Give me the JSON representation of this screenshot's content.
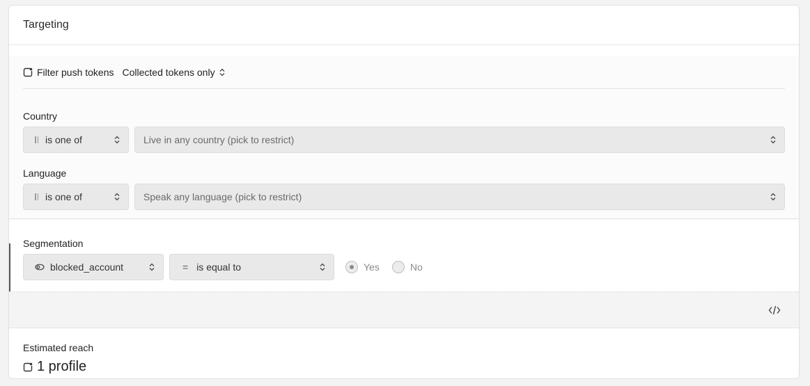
{
  "card": {
    "title": "Targeting"
  },
  "push": {
    "label": "Filter push tokens",
    "value": "Collected tokens only"
  },
  "country": {
    "label": "Country",
    "operator": "is one of",
    "placeholder": "Live in any country (pick to restrict)"
  },
  "language": {
    "label": "Language",
    "operator": "is one of",
    "placeholder": "Speak any language (pick to restrict)"
  },
  "segmentation": {
    "label": "Segmentation",
    "attribute": "blocked_account",
    "comparator_symbol": "=",
    "comparator": "is equal to",
    "options": [
      "Yes",
      "No"
    ],
    "selected": "Yes"
  },
  "reach": {
    "label": "Estimated reach",
    "value": "1 profile"
  },
  "icons": {
    "push_filter": "device-icon",
    "operator": "bars-icon",
    "attribute": "eye-icon",
    "dropdown": "chevron-up-down-icon",
    "code": "code-icon",
    "reach": "device-icon"
  }
}
